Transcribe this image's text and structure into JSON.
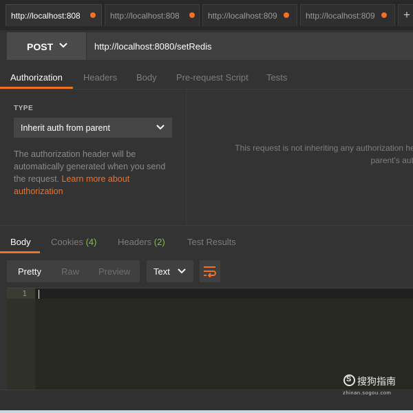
{
  "tabs": [
    {
      "label": "http://localhost:808",
      "unsaved": true,
      "active": true
    },
    {
      "label": "http://localhost:808",
      "unsaved": true,
      "active": false
    },
    {
      "label": "http://localhost:809",
      "unsaved": true,
      "active": false
    },
    {
      "label": "http://localhost:809",
      "unsaved": true,
      "active": false
    }
  ],
  "tab_add_label": "+",
  "request": {
    "method": "POST",
    "url": "http://localhost:8080/setRedis"
  },
  "request_tabs": [
    "Authorization",
    "Headers",
    "Body",
    "Pre-request Script",
    "Tests"
  ],
  "auth": {
    "type_label": "TYPE",
    "type_value": "Inherit auth from parent",
    "description": "The authorization header will be automatically generated when you send the request.",
    "learn_more": "Learn more about authorization",
    "notice_line1": "This request is not inheriting any authorization he",
    "notice_line2": "parent's auth"
  },
  "response_tabs": {
    "body": "Body",
    "cookies": "Cookies",
    "cookies_count": "(4)",
    "headers": "Headers",
    "headers_count": "(2)",
    "test_results": "Test Results"
  },
  "format": {
    "modes": [
      "Pretty",
      "Raw",
      "Preview"
    ],
    "selected_mode": "Pretty",
    "type": "Text"
  },
  "editor": {
    "line_number": "1"
  },
  "watermark": {
    "logo": "S",
    "name": "搜狗指南",
    "url": "zhinan.sogou.com"
  },
  "colors": {
    "accent": "#f47023",
    "count_green": "#7ec33a",
    "background": "#333333"
  }
}
